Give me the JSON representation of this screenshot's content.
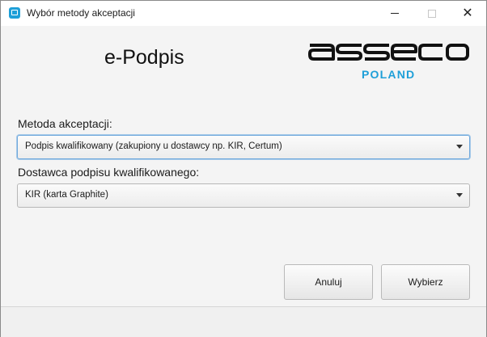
{
  "window": {
    "title": "Wybór metody akceptacji",
    "icon": "app-icon",
    "controls": [
      "minimize-icon",
      "maximize-icon",
      "close-icon"
    ]
  },
  "header": {
    "product_name": "e-Podpis",
    "logo_text": "asseco",
    "logo_region": "POLAND",
    "brand_color": "#1e9fd8"
  },
  "form": {
    "method_label": "Metoda akceptacji:",
    "method_value": "Podpis kwalifikowany (zakupiony u dostawcy np. KIR, Certum)",
    "provider_label": "Dostawca podpisu kwalifikowanego:",
    "provider_value": "KIR (karta Graphite)"
  },
  "buttons": {
    "cancel_label": "Anuluj",
    "choose_label": "Wybierz"
  }
}
